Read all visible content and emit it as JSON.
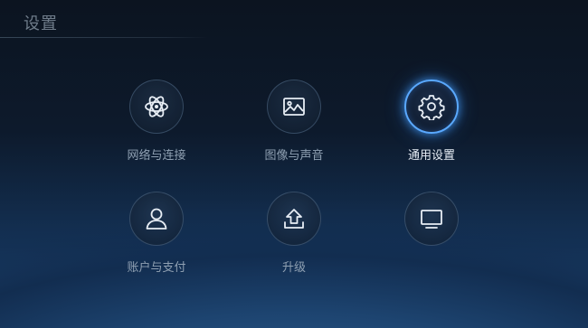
{
  "header": {
    "title": "设置"
  },
  "menu": {
    "items": [
      {
        "label": "网络与连接",
        "icon": "atom-icon",
        "selected": false
      },
      {
        "label": "图像与声音",
        "icon": "picture-icon",
        "selected": false
      },
      {
        "label": "通用设置",
        "icon": "gear-icon",
        "selected": true
      },
      {
        "label": "账户与支付",
        "icon": "user-icon",
        "selected": false
      },
      {
        "label": "升级",
        "icon": "upgrade-icon",
        "selected": false
      },
      {
        "label": "",
        "icon": "tv-icon",
        "selected": false
      }
    ]
  },
  "colors": {
    "accent": "#5aa9ff",
    "label": "#8fa0b2",
    "label_active": "#e6edf5"
  }
}
